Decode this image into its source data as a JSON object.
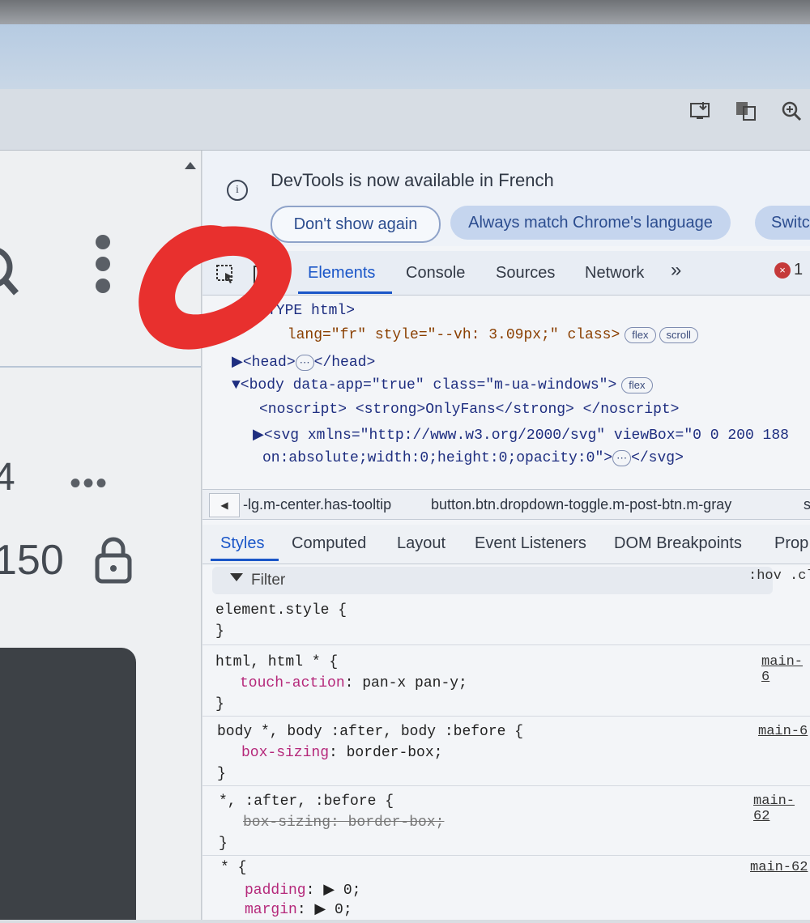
{
  "left_page": {
    "count_partial": "4",
    "count_150": "150"
  },
  "devtools": {
    "notice": {
      "text": "DevTools is now available in French",
      "btn_dont_show": "Don't show again",
      "btn_always_match": "Always match Chrome's language",
      "btn_switch": "Switc"
    },
    "tabs": {
      "elements": "Elements",
      "console": "Console",
      "sources": "Sources",
      "network": "Network",
      "more": "»",
      "error_count": "1",
      "error_symbol": "×"
    },
    "dom_lines": {
      "l1": "<!DOCTYPE html>",
      "l2_attr": " lang=\"fr\" style=\"--vh: 3.09px;\" class>",
      "l2_pill1": "flex",
      "l2_pill2": "scroll",
      "l3": "▶<head>",
      "l3_end": "</head>",
      "l4": "▼<body data-app=\"true\" class=\"m-ua-windows\">",
      "l4_pill": "flex",
      "l5": "<noscript> <strong>OnlyFans</strong> </noscript>",
      "l6": "▶<svg xmlns=\"http://www.w3.org/2000/svg\" viewBox=\"0 0 200 188",
      "l7": "on:absolute;width:0;height:0;opacity:0\">",
      "l7_end": "</svg>"
    },
    "breadcrumbs": {
      "c1": "-lg.m-center.has-tooltip",
      "c2": "button.btn.dropdown-toggle.m-post-btn.m-gray",
      "c3": "s"
    },
    "subtabs": {
      "styles": "Styles",
      "computed": "Computed",
      "layout": "Layout",
      "event_listeners": "Event Listeners",
      "dom_breakpoints": "DOM Breakpoints",
      "properties": "Prop"
    },
    "filter": {
      "placeholder": "Filter",
      "hov_cls": ":hov .cl"
    },
    "styles": {
      "r1_sel": "element.style {",
      "r1_close": "}",
      "r2_sel": "html, html * {",
      "r2_prop": "touch-action",
      "r2_val": ": pan-x pan-y;",
      "r2_close": "}",
      "r2_src": "main-6",
      "r3_sel": "body *, body :after, body :before {",
      "r3_prop": "box-sizing",
      "r3_val": ": border-box;",
      "r3_close": "}",
      "r3_src": "main-6",
      "r4_sel": "*, :after, :before {",
      "r4_strike": "box-sizing: border-box;",
      "r4_close": "}",
      "r4_src": "main-62",
      "r5_sel": "* {",
      "r5_prop1": "padding",
      "r5_val1": ": ▶ 0;",
      "r5_prop2": "margin",
      "r5_val2": ": ▶ 0;",
      "r5_src": "main-62"
    }
  },
  "colors": {
    "accent": "#1a56c8",
    "annotation_red": "#e8302e"
  }
}
